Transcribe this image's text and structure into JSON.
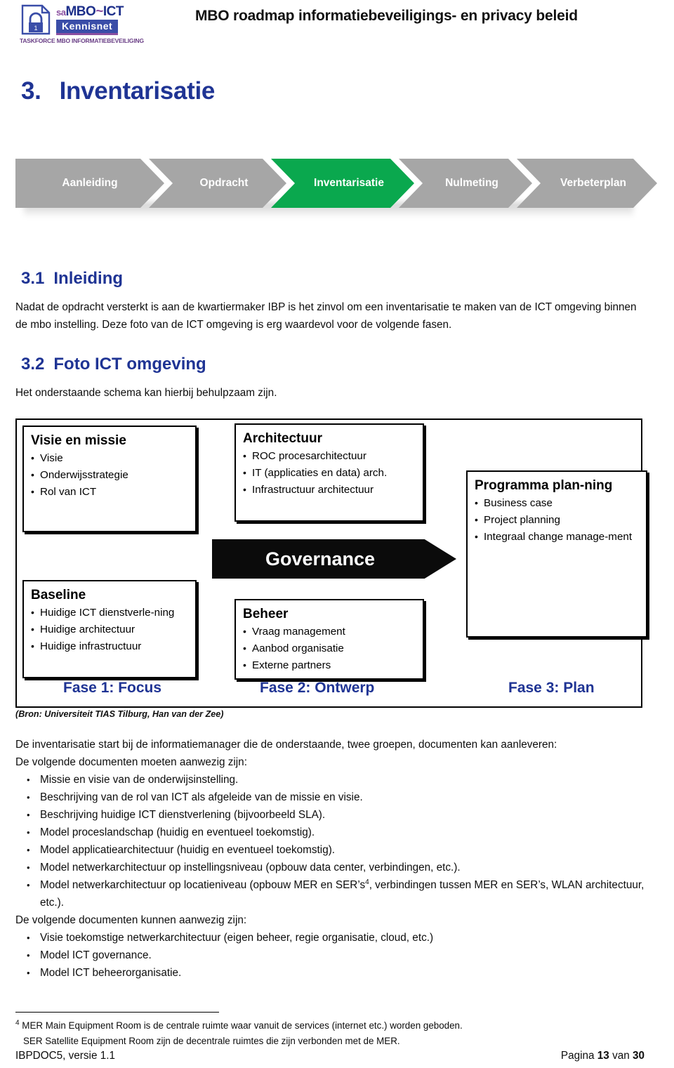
{
  "header": {
    "logo": {
      "doc_icon": "locked-document-icon",
      "brand_sa": "sa",
      "brand_mbo": "MBO",
      "brand_tilde": "~",
      "brand_ict": "ICT",
      "kennisnet": "Kennisnet",
      "taskforce": "TASKFORCE MBO INFORMATIEBEVEILIGING"
    },
    "title": "MBO roadmap informatiebeveiligings- en privacy beleid"
  },
  "chapter": {
    "number": "3.",
    "title": "Inventarisatie"
  },
  "process": {
    "active_color": "#0aa84e",
    "inactive_color": "#a6a6a6",
    "steps": [
      {
        "label": "Aanleiding",
        "active": false
      },
      {
        "label": "Opdracht",
        "active": false
      },
      {
        "label": "Inventarisatie",
        "active": true
      },
      {
        "label": "Nulmeting",
        "active": false
      },
      {
        "label": "Verbeterplan",
        "active": false
      }
    ]
  },
  "sections": {
    "s31": {
      "number": "3.1",
      "title": "Inleiding",
      "body": "Nadat de opdracht versterkt is aan de kwartiermaker IBP is het zinvol om een inventarisatie te maken van de ICT omgeving binnen de mbo instelling. Deze foto van de ICT omgeving is erg waardevol voor de volgende fasen."
    },
    "s32": {
      "number": "3.2",
      "title": "Foto ICT omgeving",
      "body": "Het onderstaande schema kan hierbij behulpzaam zijn."
    }
  },
  "schema": {
    "boxes": {
      "visie": {
        "title": "Visie en missie",
        "items": [
          "Visie",
          "Onderwijsstrategie",
          "Rol van ICT"
        ]
      },
      "baseline": {
        "title": "Baseline",
        "items": [
          "Huidige ICT dienstverle-ning",
          "Huidige architectuur",
          "Huidige infrastructuur"
        ]
      },
      "architectuur": {
        "title": "Architectuur",
        "items": [
          "ROC procesarchitectuur",
          "IT (applicaties en data) arch.",
          "Infrastructuur architectuur"
        ]
      },
      "beheer": {
        "title": "Beheer",
        "items": [
          "Vraag management",
          "Aanbod organisatie",
          "Externe partners"
        ]
      },
      "programma": {
        "title": "Programma plan-ning",
        "items": [
          "Business case",
          "Project planning",
          "Integraal change manage-ment"
        ]
      }
    },
    "governance": "Governance",
    "fases": [
      {
        "label": "Fase 1: Focus"
      },
      {
        "label": "Fase 2: Ontwerp"
      },
      {
        "label": "Fase 3: Plan"
      }
    ],
    "source": "(Bron: Universiteit TIAS Tilburg, Han van der Zee)"
  },
  "prose": {
    "intro": "De inventarisatie start bij de informatiemanager die de onderstaande, twee groepen, documenten kan aanleveren:",
    "must_header": "De volgende documenten moeten aanwezig zijn:",
    "must_items": [
      "Missie en visie van de onderwijsinstelling.",
      "Beschrijving van de rol van ICT als afgeleide van de missie en visie.",
      "Beschrijving huidige ICT dienstverlening (bijvoorbeeld SLA).",
      "Model proceslandschap (huidig en eventueel toekomstig).",
      "Model applicatiearchitectuur (huidig en eventueel toekomstig).",
      "Model netwerkarchitectuur op instellingsniveau (opbouw data center, verbindingen, etc.)."
    ],
    "must_item_footnote_a": "Model netwerkarchitectuur op locatieniveau (opbouw MER en SER’s",
    "must_item_footnote_marker": "4",
    "must_item_footnote_b": ", verbindingen tussen MER en SER’s, WLAN architectuur, etc.).",
    "may_header": "De volgende documenten kunnen aanwezig zijn:",
    "may_items": [
      "Visie toekomstige netwerkarchitectuur (eigen beheer, regie organisatie, cloud, etc.)",
      "Model ICT governance.",
      "Model ICT beheerorganisatie."
    ]
  },
  "footnote": {
    "marker": "4",
    "line1": "MER Main Equipment Room is de centrale ruimte waar vanuit de services (internet etc.) worden geboden.",
    "line2": "SER Satellite Equipment Room zijn de decentrale ruimtes die zijn verbonden met de MER."
  },
  "footer": {
    "left": "IBPDOC5, versie 1.1",
    "page_word": "Pagina",
    "page_number": "13",
    "of_word": "van",
    "page_total": "30"
  }
}
